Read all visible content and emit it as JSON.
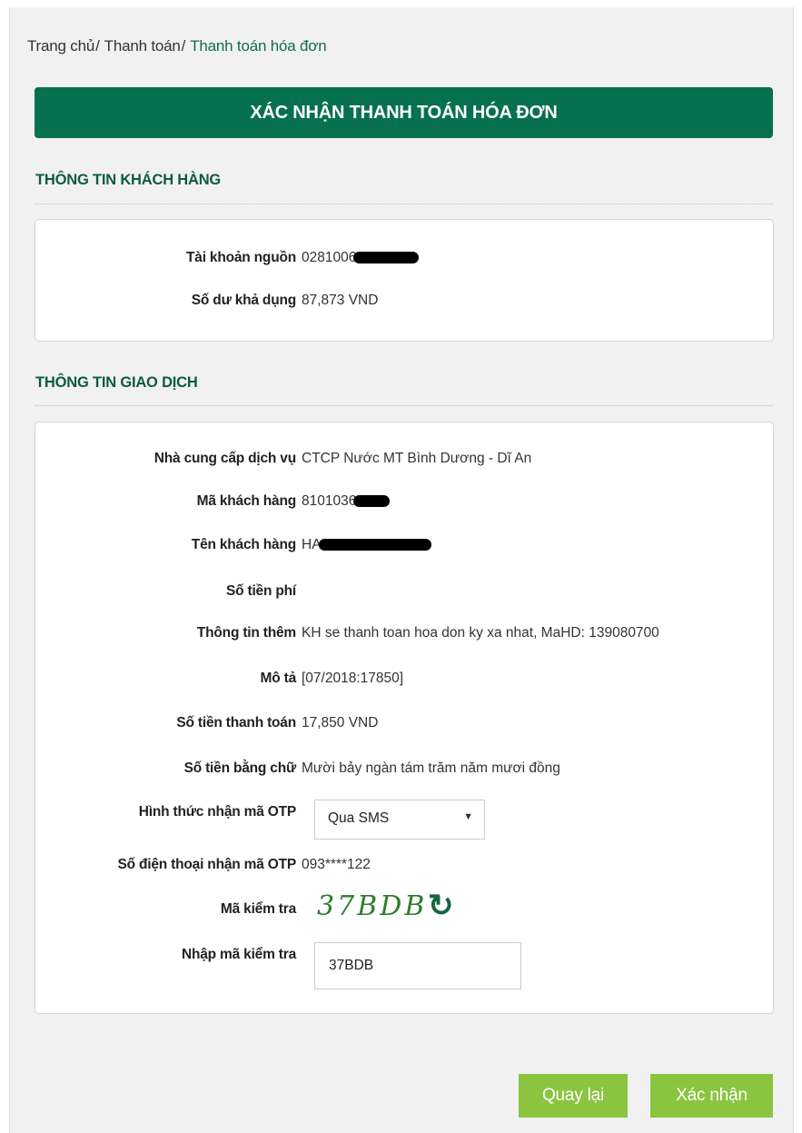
{
  "breadcrumb": {
    "items": [
      "Trang chủ",
      "Thanh toán"
    ],
    "current": "Thanh toán hóa đơn"
  },
  "title": "XÁC NHẬN THANH TOÁN HÓA ĐƠN",
  "customer_section": {
    "title": "THÔNG TIN KHÁCH HÀNG",
    "source_account": {
      "label": "Tài khoản nguồn",
      "value": "0281006"
    },
    "balance": {
      "label": "Số dư khả dụng",
      "value": "87,873 VND"
    }
  },
  "transaction_section": {
    "title": "THÔNG TIN GIAO DỊCH",
    "provider": {
      "label": "Nhà cung cấp dịch vụ",
      "value": "CTCP Nước MT Bình Dương - Dĩ An"
    },
    "customer_code": {
      "label": "Mã khách hàng",
      "value": "8101036"
    },
    "customer_name": {
      "label": "Tên khách hàng",
      "value": "HA"
    },
    "fee": {
      "label": "Số tiền phí",
      "value": ""
    },
    "extra_info": {
      "label": "Thông tin thêm",
      "value": "KH se thanh toan hoa don ky xa nhat, MaHD: 139080700"
    },
    "description": {
      "label": "Mô tả",
      "value": "[07/2018:17850]"
    },
    "amount": {
      "label": "Số tiền thanh toán",
      "value": "17,850 VND"
    },
    "amount_words": {
      "label": "Số tiền bằng chữ",
      "value": "Mười bảy ngàn tám trăm năm mươi đồng"
    },
    "otp_method": {
      "label": "Hình thức nhận mã OTP",
      "value": "Qua SMS"
    },
    "otp_phone": {
      "label": "Số điện thoại nhận mã OTP",
      "value": "093****122"
    },
    "captcha": {
      "label": "Mã kiểm tra",
      "value": "37BDB"
    },
    "captcha_input": {
      "label": "Nhập mã kiểm tra",
      "value": "37BDB"
    }
  },
  "buttons": {
    "back": "Quay lại",
    "confirm": "Xác nhận"
  },
  "icons": {
    "refresh": "refresh-icon",
    "dropdown": "chevron-down-icon"
  },
  "colors": {
    "primary": "#07704f",
    "button": "#8bc53f",
    "section_title": "#0d5a44"
  }
}
